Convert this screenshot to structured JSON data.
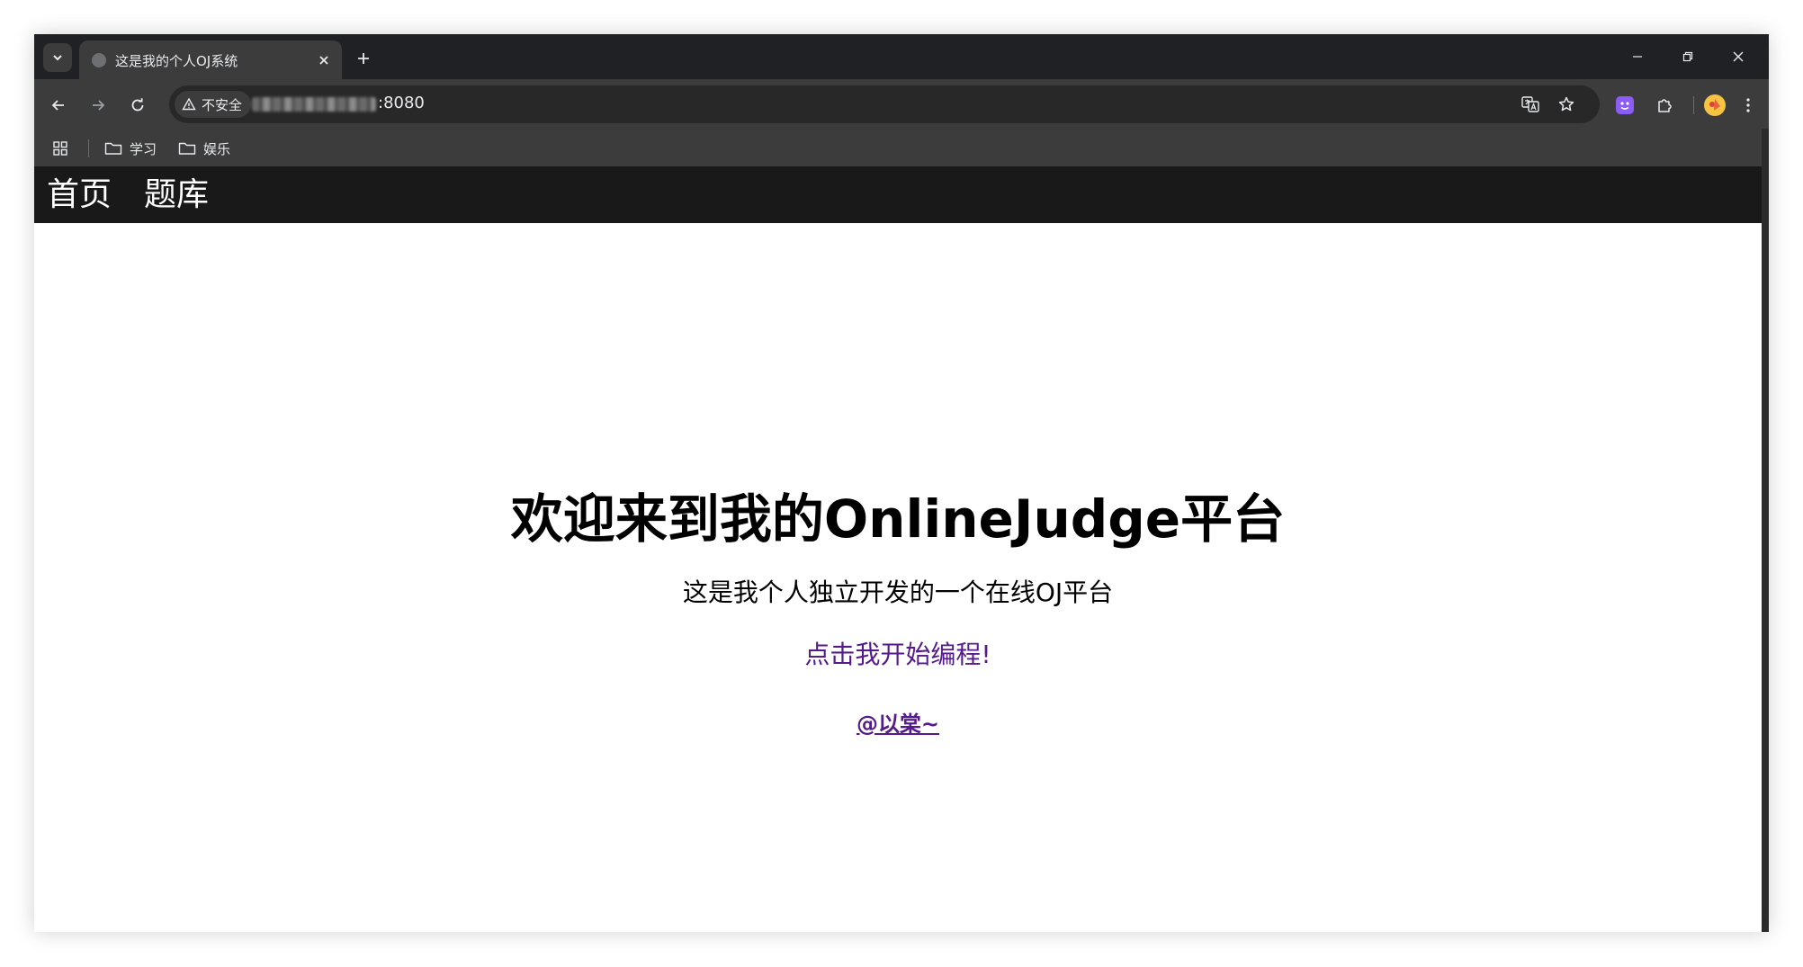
{
  "browser": {
    "tab_title": "这是我的个人OJ系统",
    "security_label": "不安全",
    "url_visible": ":8080",
    "bookmarks": [
      "学习",
      "娱乐"
    ]
  },
  "nav": {
    "items": [
      "首页",
      "题库"
    ]
  },
  "hero": {
    "title": "欢迎来到我的OnlineJudge平台",
    "subtitle": "这是我个人独立开发的一个在线OJ平台",
    "start_link": "点击我开始编程!",
    "author": "@以棠~"
  },
  "colors": {
    "link_visited": "#551a8b",
    "navbar_bg": "#191919",
    "chrome_dark": "#202124",
    "toolbar": "#3c3c3c"
  }
}
